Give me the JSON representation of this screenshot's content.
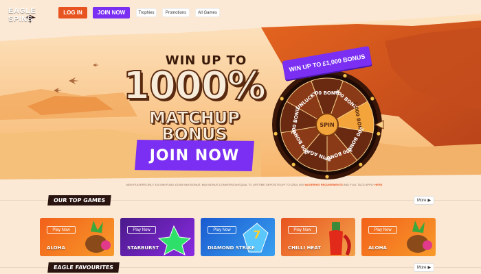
{
  "header": {
    "logo_text": "EAGLE SPINS",
    "login_label": "LOG IN",
    "join_label": "JOIN NOW",
    "nav": [
      "Trophies",
      "Promotions",
      "All Games"
    ]
  },
  "promo": {
    "line1": "WIN UP TO",
    "line2": "1000%",
    "line3": "MATCHUP BONUS",
    "join_label": "JOIN NOW",
    "terms_text": "NEW PLAYERS ONLY, £10 MIN FUND, £1000 MAX BONUS, MAX BONUS CONVERSION EQUAL TO LIFETIME DEPOSITS (UP TO £250), 65X",
    "terms_link1": "WAGERING REQUIREMENTS",
    "terms_mid": "AND FULL T&CS APPLY",
    "terms_link2": "HERE"
  },
  "wheel": {
    "banner": "WIN UP TO £1,000 BONUS",
    "center": "SPIN",
    "segments": [
      "100 BONUS",
      "300 BONUS",
      "1,000 BONUS",
      "200 BONUS",
      "100 BONUS",
      "SPIN AGAIN",
      "500 BONUS",
      "300 BONUS",
      "UNLUCKY"
    ]
  },
  "top_games": {
    "title": "OUR TOP GAMES",
    "more_label": "More",
    "play_label": "Play Now",
    "games": [
      {
        "name": "ALOHA",
        "bg1": "#f2611a",
        "bg2": "#f89a2a"
      },
      {
        "name": "STARBURST",
        "bg1": "#4a1a8a",
        "bg2": "#8a2ae2"
      },
      {
        "name": "DIAMOND STRIKE",
        "bg1": "#1a5ad0",
        "bg2": "#39a0f0"
      },
      {
        "name": "CHILLI HEAT",
        "bg1": "#e8541f",
        "bg2": "#f3a14a"
      },
      {
        "name": "ALOHA",
        "bg1": "#f2611a",
        "bg2": "#f89a2a"
      }
    ]
  },
  "favourites": {
    "title": "EAGLE FAVOURITES",
    "more_label": "More"
  },
  "colors": {
    "accent_purple": "#7b2ff2",
    "accent_orange": "#e8541f",
    "dark": "#2a1410"
  }
}
